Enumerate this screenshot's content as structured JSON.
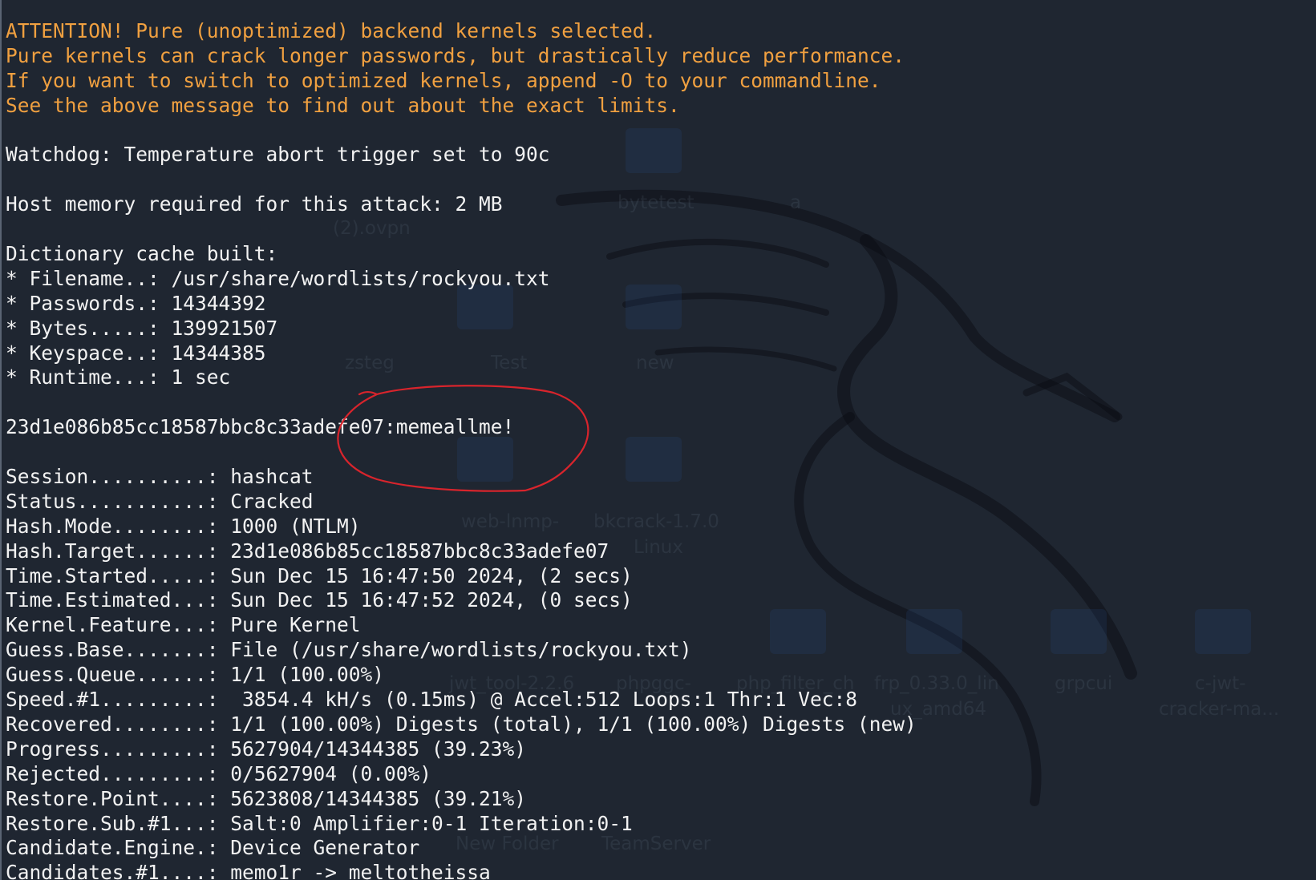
{
  "theme": {
    "background": "#1f2631",
    "text_color": "#f2f2f2",
    "warning_color": "#f0a040",
    "annotation_color": "#d8242c"
  },
  "desktop_labels": [
    "bytetest",
    "a",
    "(2).ovpn",
    "zsteg",
    "Test",
    "new",
    "web-lnmp-",
    "bkcrack-1.7.0",
    "Linux",
    "jwt_tool-2.2.6",
    "phpggc-",
    "php_filter_ch",
    "frp_0.33.0_lin",
    "ux_amd64",
    "grpcui",
    "c-jwt-",
    "cracker-ma...",
    "New Folder",
    "TeamServer"
  ],
  "terminal": {
    "lines": [
      {
        "text": "ATTENTION! Pure (unoptimized) backend kernels selected.",
        "style": "warn"
      },
      {
        "text": "Pure kernels can crack longer passwords, but drastically reduce performance.",
        "style": "warn"
      },
      {
        "text": "If you want to switch to optimized kernels, append -O to your commandline.",
        "style": "warn"
      },
      {
        "text": "See the above message to find out about the exact limits.",
        "style": "warn"
      },
      {
        "text": "",
        "style": "normal"
      },
      {
        "text": "Watchdog: Temperature abort trigger set to 90c",
        "style": "normal"
      },
      {
        "text": "",
        "style": "normal"
      },
      {
        "text": "Host memory required for this attack: 2 MB",
        "style": "normal"
      },
      {
        "text": "",
        "style": "normal"
      },
      {
        "text": "Dictionary cache built:",
        "style": "normal"
      },
      {
        "text": "* Filename..: /usr/share/wordlists/rockyou.txt",
        "style": "normal"
      },
      {
        "text": "* Passwords.: 14344392",
        "style": "normal"
      },
      {
        "text": "* Bytes.....: 139921507",
        "style": "normal"
      },
      {
        "text": "* Keyspace..: 14344385",
        "style": "normal"
      },
      {
        "text": "* Runtime...: 1 sec",
        "style": "normal"
      },
      {
        "text": "",
        "style": "normal"
      },
      {
        "text": "23d1e086b85cc18587bbc8c33adefe07:memeallme!",
        "style": "normal"
      },
      {
        "text": "",
        "style": "normal"
      },
      {
        "text": "Session..........: hashcat",
        "style": "normal"
      },
      {
        "text": "Status...........: Cracked",
        "style": "normal"
      },
      {
        "text": "Hash.Mode........: 1000 (NTLM)",
        "style": "normal"
      },
      {
        "text": "Hash.Target......: 23d1e086b85cc18587bbc8c33adefe07",
        "style": "normal"
      },
      {
        "text": "Time.Started.....: Sun Dec 15 16:47:50 2024, (2 secs)",
        "style": "normal"
      },
      {
        "text": "Time.Estimated...: Sun Dec 15 16:47:52 2024, (0 secs)",
        "style": "normal"
      },
      {
        "text": "Kernel.Feature...: Pure Kernel",
        "style": "normal"
      },
      {
        "text": "Guess.Base.......: File (/usr/share/wordlists/rockyou.txt)",
        "style": "normal"
      },
      {
        "text": "Guess.Queue......: 1/1 (100.00%)",
        "style": "normal"
      },
      {
        "text": "Speed.#1.........:  3854.4 kH/s (0.15ms) @ Accel:512 Loops:1 Thr:1 Vec:8",
        "style": "normal"
      },
      {
        "text": "Recovered........: 1/1 (100.00%) Digests (total), 1/1 (100.00%) Digests (new)",
        "style": "normal"
      },
      {
        "text": "Progress.........: 5627904/14344385 (39.23%)",
        "style": "normal"
      },
      {
        "text": "Rejected.........: 0/5627904 (0.00%)",
        "style": "normal"
      },
      {
        "text": "Restore.Point....: 5623808/14344385 (39.21%)",
        "style": "normal"
      },
      {
        "text": "Restore.Sub.#1...: Salt:0 Amplifier:0-1 Iteration:0-1",
        "style": "normal"
      },
      {
        "text": "Candidate.Engine.: Device Generator",
        "style": "normal"
      },
      {
        "text": "Candidates.#1....: memo1r -> meltotheissa",
        "style": "normal"
      }
    ]
  }
}
